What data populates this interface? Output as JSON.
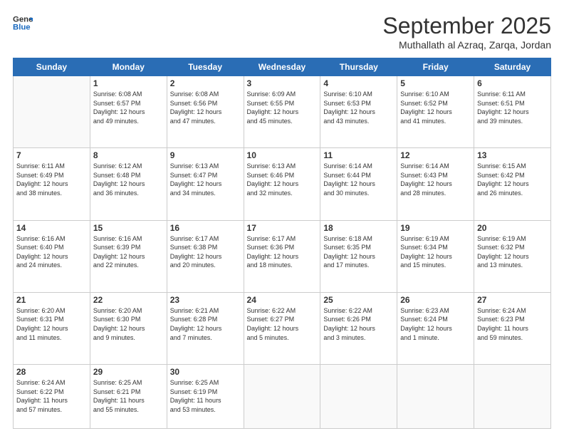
{
  "logo": {
    "line1": "General",
    "line2": "Blue"
  },
  "header": {
    "month": "September 2025",
    "location": "Muthallath al Azraq, Zarqa, Jordan"
  },
  "days": [
    "Sunday",
    "Monday",
    "Tuesday",
    "Wednesday",
    "Thursday",
    "Friday",
    "Saturday"
  ],
  "weeks": [
    [
      {
        "day": "",
        "info": ""
      },
      {
        "day": "1",
        "info": "Sunrise: 6:08 AM\nSunset: 6:57 PM\nDaylight: 12 hours\nand 49 minutes."
      },
      {
        "day": "2",
        "info": "Sunrise: 6:08 AM\nSunset: 6:56 PM\nDaylight: 12 hours\nand 47 minutes."
      },
      {
        "day": "3",
        "info": "Sunrise: 6:09 AM\nSunset: 6:55 PM\nDaylight: 12 hours\nand 45 minutes."
      },
      {
        "day": "4",
        "info": "Sunrise: 6:10 AM\nSunset: 6:53 PM\nDaylight: 12 hours\nand 43 minutes."
      },
      {
        "day": "5",
        "info": "Sunrise: 6:10 AM\nSunset: 6:52 PM\nDaylight: 12 hours\nand 41 minutes."
      },
      {
        "day": "6",
        "info": "Sunrise: 6:11 AM\nSunset: 6:51 PM\nDaylight: 12 hours\nand 39 minutes."
      }
    ],
    [
      {
        "day": "7",
        "info": "Sunrise: 6:11 AM\nSunset: 6:49 PM\nDaylight: 12 hours\nand 38 minutes."
      },
      {
        "day": "8",
        "info": "Sunrise: 6:12 AM\nSunset: 6:48 PM\nDaylight: 12 hours\nand 36 minutes."
      },
      {
        "day": "9",
        "info": "Sunrise: 6:13 AM\nSunset: 6:47 PM\nDaylight: 12 hours\nand 34 minutes."
      },
      {
        "day": "10",
        "info": "Sunrise: 6:13 AM\nSunset: 6:46 PM\nDaylight: 12 hours\nand 32 minutes."
      },
      {
        "day": "11",
        "info": "Sunrise: 6:14 AM\nSunset: 6:44 PM\nDaylight: 12 hours\nand 30 minutes."
      },
      {
        "day": "12",
        "info": "Sunrise: 6:14 AM\nSunset: 6:43 PM\nDaylight: 12 hours\nand 28 minutes."
      },
      {
        "day": "13",
        "info": "Sunrise: 6:15 AM\nSunset: 6:42 PM\nDaylight: 12 hours\nand 26 minutes."
      }
    ],
    [
      {
        "day": "14",
        "info": "Sunrise: 6:16 AM\nSunset: 6:40 PM\nDaylight: 12 hours\nand 24 minutes."
      },
      {
        "day": "15",
        "info": "Sunrise: 6:16 AM\nSunset: 6:39 PM\nDaylight: 12 hours\nand 22 minutes."
      },
      {
        "day": "16",
        "info": "Sunrise: 6:17 AM\nSunset: 6:38 PM\nDaylight: 12 hours\nand 20 minutes."
      },
      {
        "day": "17",
        "info": "Sunrise: 6:17 AM\nSunset: 6:36 PM\nDaylight: 12 hours\nand 18 minutes."
      },
      {
        "day": "18",
        "info": "Sunrise: 6:18 AM\nSunset: 6:35 PM\nDaylight: 12 hours\nand 17 minutes."
      },
      {
        "day": "19",
        "info": "Sunrise: 6:19 AM\nSunset: 6:34 PM\nDaylight: 12 hours\nand 15 minutes."
      },
      {
        "day": "20",
        "info": "Sunrise: 6:19 AM\nSunset: 6:32 PM\nDaylight: 12 hours\nand 13 minutes."
      }
    ],
    [
      {
        "day": "21",
        "info": "Sunrise: 6:20 AM\nSunset: 6:31 PM\nDaylight: 12 hours\nand 11 minutes."
      },
      {
        "day": "22",
        "info": "Sunrise: 6:20 AM\nSunset: 6:30 PM\nDaylight: 12 hours\nand 9 minutes."
      },
      {
        "day": "23",
        "info": "Sunrise: 6:21 AM\nSunset: 6:28 PM\nDaylight: 12 hours\nand 7 minutes."
      },
      {
        "day": "24",
        "info": "Sunrise: 6:22 AM\nSunset: 6:27 PM\nDaylight: 12 hours\nand 5 minutes."
      },
      {
        "day": "25",
        "info": "Sunrise: 6:22 AM\nSunset: 6:26 PM\nDaylight: 12 hours\nand 3 minutes."
      },
      {
        "day": "26",
        "info": "Sunrise: 6:23 AM\nSunset: 6:24 PM\nDaylight: 12 hours\nand 1 minute."
      },
      {
        "day": "27",
        "info": "Sunrise: 6:24 AM\nSunset: 6:23 PM\nDaylight: 11 hours\nand 59 minutes."
      }
    ],
    [
      {
        "day": "28",
        "info": "Sunrise: 6:24 AM\nSunset: 6:22 PM\nDaylight: 11 hours\nand 57 minutes."
      },
      {
        "day": "29",
        "info": "Sunrise: 6:25 AM\nSunset: 6:21 PM\nDaylight: 11 hours\nand 55 minutes."
      },
      {
        "day": "30",
        "info": "Sunrise: 6:25 AM\nSunset: 6:19 PM\nDaylight: 11 hours\nand 53 minutes."
      },
      {
        "day": "",
        "info": ""
      },
      {
        "day": "",
        "info": ""
      },
      {
        "day": "",
        "info": ""
      },
      {
        "day": "",
        "info": ""
      }
    ]
  ]
}
